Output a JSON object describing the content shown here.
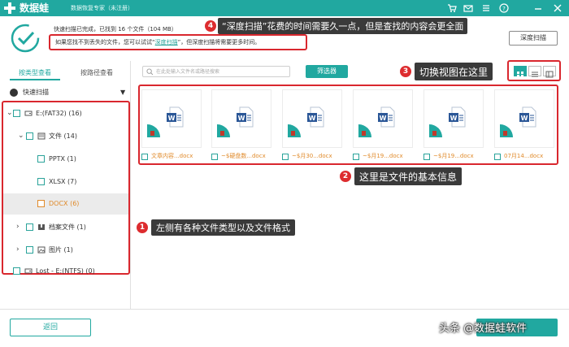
{
  "app": {
    "brand": "数据蛙",
    "subtitle": "数据恢复专家（未注册）",
    "window_buttons": [
      "cart-icon",
      "mail-icon",
      "menu-icon",
      "help-icon",
      "minimize-icon",
      "close-icon"
    ]
  },
  "header": {
    "status": "快速扫描已完成，已找到 16 个文件（104 MB）",
    "hint_before": "如果您找不到丢失的文件，您可以试试“",
    "hint_link": "深度扫描",
    "hint_after": "”，但深度扫描将需要更多时间。",
    "deep_scan_button": "深度扫描"
  },
  "callouts": {
    "c1": {
      "num": "1",
      "text": "左侧有各种文件类型以及文件格式"
    },
    "c2": {
      "num": "2",
      "text": "这里是文件的基本信息"
    },
    "c3": {
      "num": "3",
      "text": "切换视图在这里"
    },
    "c4": {
      "num": "4",
      "text": "“深度扫描”花费的时间需要久一点，但是查找的内容会更全面"
    }
  },
  "sidebar": {
    "tabs": [
      "按类型查看",
      "按路径查看"
    ],
    "quick_scan": "快速扫描",
    "tree": [
      {
        "label": "E:(FAT32) (16)",
        "icon": "drive-icon"
      },
      {
        "label": "文件 (14)",
        "icon": "file-folder-icon"
      },
      {
        "label": "PPTX (1)"
      },
      {
        "label": "XLSX (7)"
      },
      {
        "label": "DOCX (6)",
        "selected": true
      },
      {
        "label": "档案文件 (1)",
        "icon": "archive-icon"
      },
      {
        "label": "图片 (1)",
        "icon": "image-icon"
      },
      {
        "label": "Lost - E:(NTFS) (0)",
        "icon": "drive-icon"
      }
    ]
  },
  "main": {
    "search_placeholder": "在此处输入文件名或路径搜索",
    "filter_button": "筛选器",
    "views": [
      "grid-view-icon",
      "list-view-icon",
      "detail-view-icon"
    ],
    "files": [
      {
        "name": "文章内容...docx"
      },
      {
        "name": "~$硬盘数...docx"
      },
      {
        "name": "~$月30...docx"
      },
      {
        "name": "~$月19...docx"
      },
      {
        "name": "~$月19...docx"
      },
      {
        "name": "07月14...docx"
      }
    ]
  },
  "footer": {
    "back_button": "返回",
    "watermark": "头条 @数据蛙软件"
  },
  "colors": {
    "accent": "#21a8a0",
    "highlight": "#d9272e",
    "file_name": "#e08a2a",
    "callout_bg": "#3a3a3a"
  }
}
